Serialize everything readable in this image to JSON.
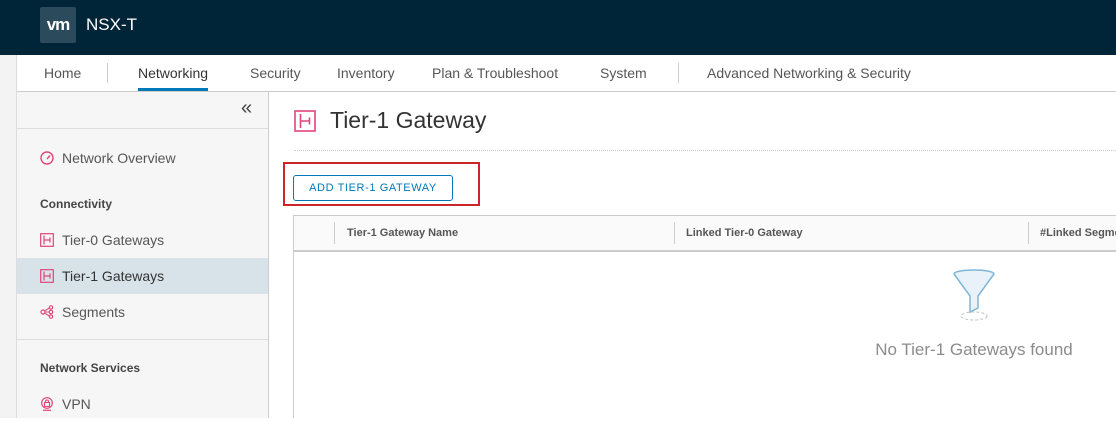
{
  "header": {
    "logo_text": "vm",
    "app_title": "NSX-T",
    "bg_color": "#002538"
  },
  "nav": {
    "tabs": [
      "Home",
      "Networking",
      "Security",
      "Inventory",
      "Plan & Troubleshoot",
      "System",
      "Advanced Networking & Security"
    ],
    "active": "Networking",
    "accent_color": "#0079b8"
  },
  "sidebar": {
    "collapse_glyph": "«",
    "overview": {
      "label": "Network Overview",
      "icon": "gauge-icon"
    },
    "sections": [
      {
        "title": "Connectivity",
        "items": [
          {
            "label": "Tier-0 Gateways",
            "icon": "gateway-icon"
          },
          {
            "label": "Tier-1 Gateways",
            "icon": "gateway-icon",
            "selected": true
          },
          {
            "label": "Segments",
            "icon": "segments-icon"
          }
        ]
      },
      {
        "title": "Network Services",
        "items": [
          {
            "label": "VPN",
            "icon": "vpn-icon"
          }
        ]
      }
    ]
  },
  "main": {
    "title": "Tier-1 Gateway",
    "title_icon": "gateway-icon",
    "add_button": "ADD TIER-1 GATEWAY",
    "grid": {
      "columns": [
        "Tier-1 Gateway Name",
        "Linked Tier-0 Gateway",
        "#Linked Segments"
      ],
      "empty_message": "No Tier-1 Gateways found",
      "empty_icon": "filter-funnel-icon"
    }
  }
}
